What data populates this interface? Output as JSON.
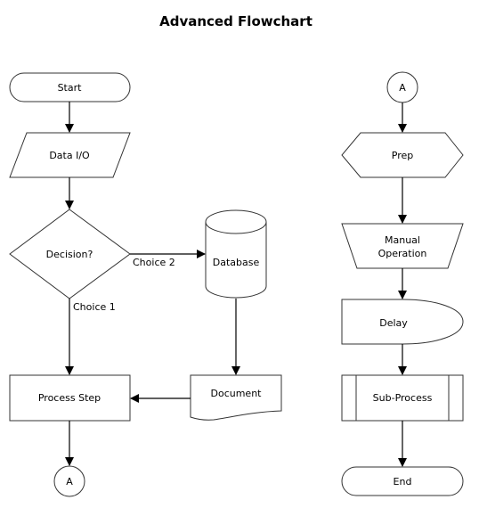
{
  "title": "Advanced Flowchart",
  "nodes": {
    "start": "Start",
    "data_io": "Data I/O",
    "decision": "Decision?",
    "database": "Database",
    "document": "Document",
    "process_step": "Process Step",
    "connector_out": "A",
    "connector_in": "A",
    "prep": "Prep",
    "manual_operation_line1": "Manual",
    "manual_operation_line2": "Operation",
    "delay": "Delay",
    "sub_process": "Sub-Process",
    "end": "End"
  },
  "edges": {
    "choice_1": "Choice 1",
    "choice_2": "Choice 2"
  },
  "colors": {
    "shape_stroke": "#333333",
    "shape_fill": "#ffffff",
    "connector": "#000000"
  }
}
